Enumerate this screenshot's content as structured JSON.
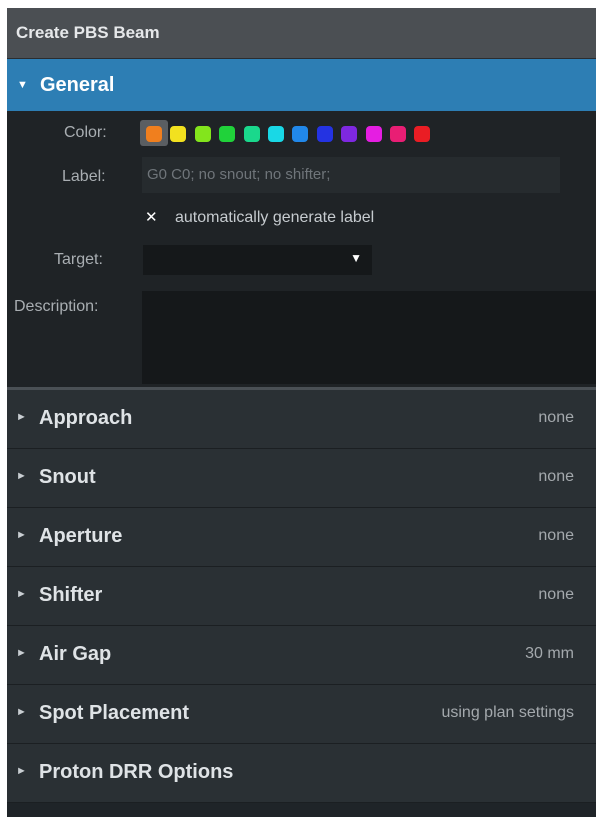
{
  "window": {
    "title": "Create PBS Beam"
  },
  "general": {
    "title": "General",
    "expand_glyph": "▼",
    "color_label": "Color:",
    "colors": [
      "#f07f1e",
      "#f2e11f",
      "#83e51c",
      "#20d23a",
      "#1ad88c",
      "#19d8e6",
      "#2188ea",
      "#2433e2",
      "#7e28e0",
      "#e51ee2",
      "#e91e74",
      "#ea1d24"
    ],
    "selected_color_index": 0,
    "label_label": "Label:",
    "label_placeholder": "G0 C0; no snout; no shifter;",
    "auto_label_checked_glyph": "✕",
    "auto_label_text": "automatically generate label",
    "target_label": "Target:",
    "target_value": "",
    "target_caret": "▼",
    "description_label": "Description:",
    "description_value": ""
  },
  "sections": [
    {
      "arrow": "►",
      "title": "Approach",
      "value": "none"
    },
    {
      "arrow": "►",
      "title": "Snout",
      "value": "none"
    },
    {
      "arrow": "►",
      "title": "Aperture",
      "value": "none"
    },
    {
      "arrow": "►",
      "title": "Shifter",
      "value": "none"
    },
    {
      "arrow": "►",
      "title": "Air Gap",
      "value": "30 mm"
    },
    {
      "arrow": "►",
      "title": "Spot Placement",
      "value": "using plan settings"
    },
    {
      "arrow": "►",
      "title": "Proton DRR Options",
      "value": ""
    }
  ]
}
